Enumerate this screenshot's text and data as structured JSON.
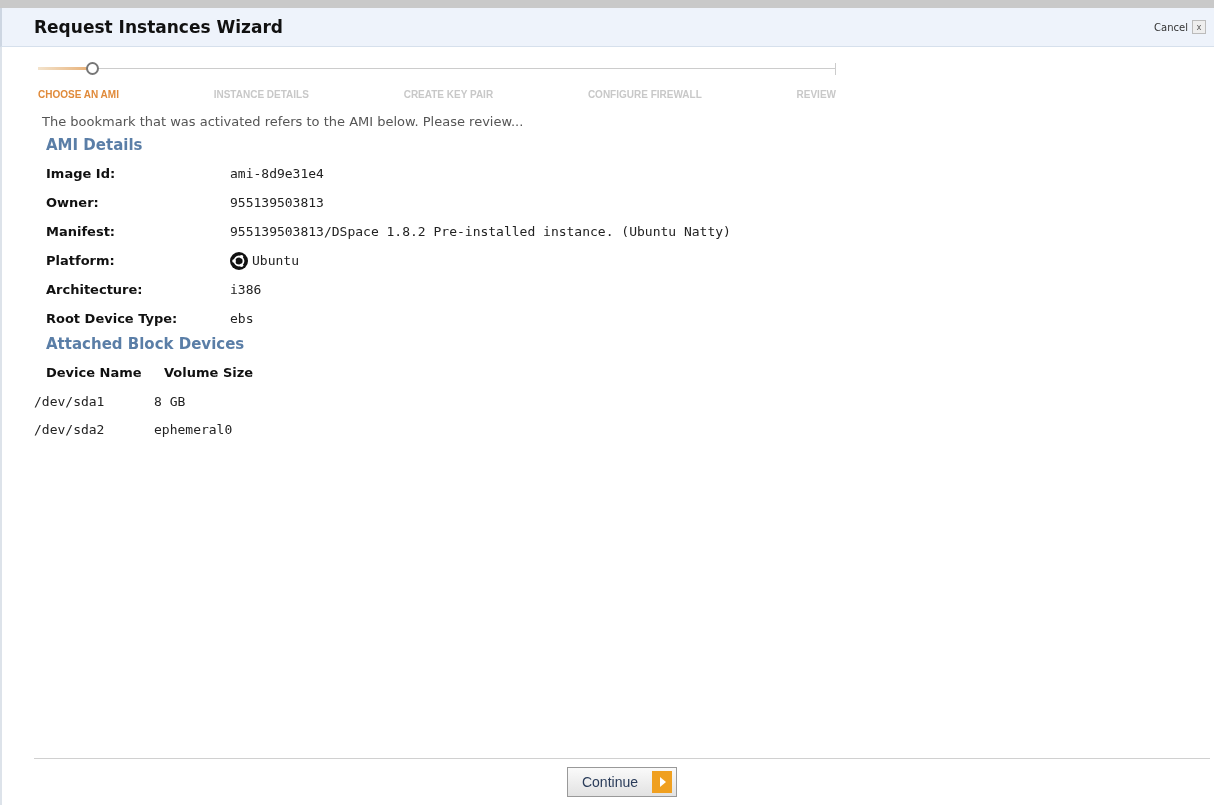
{
  "window": {
    "title": "Request Instances Wizard",
    "cancel": "Cancel",
    "close": "x"
  },
  "steps": [
    {
      "label": "CHOOSE AN AMI",
      "selected": true
    },
    {
      "label": "INSTANCE DETAILS",
      "selected": false
    },
    {
      "label": "CREATE KEY PAIR",
      "selected": false
    },
    {
      "label": "CONFIGURE FIREWALL",
      "selected": false
    },
    {
      "label": "REVIEW",
      "selected": false
    }
  ],
  "intro": "The bookmark that was activated refers to the AMI below. Please review...",
  "ami_details": {
    "heading": "AMI Details",
    "fields": [
      {
        "label": "Image Id:",
        "value": "ami-8d9e31e4"
      },
      {
        "label": "Owner:",
        "value": "955139503813"
      },
      {
        "label": "Manifest:",
        "value": "955139503813/DSpace 1.8.2 Pre-installed instance. (Ubuntu Natty)"
      },
      {
        "label": "Platform:",
        "value": "Ubuntu",
        "kind": "platform"
      },
      {
        "label": "Architecture:",
        "value": "i386"
      },
      {
        "label": "Root Device Type:",
        "value": "ebs"
      }
    ]
  },
  "block_devices": {
    "heading": "Attached Block Devices",
    "columns": [
      "Device Name",
      "Volume Size"
    ],
    "rows": [
      [
        "/dev/sda1",
        "8 GB"
      ],
      [
        "/dev/sda2",
        "ephemeral0"
      ]
    ]
  },
  "footer": {
    "continue": "Continue"
  }
}
